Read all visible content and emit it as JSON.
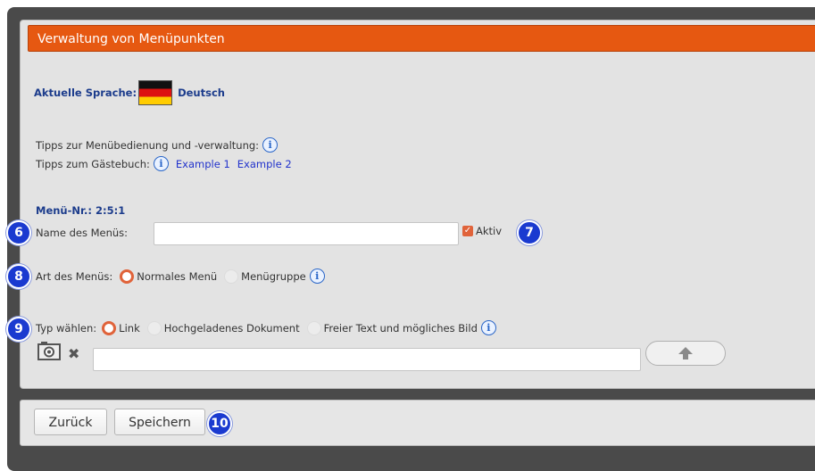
{
  "title": "Verwaltung von Menüpunkten",
  "language": {
    "label": "Aktuelle Sprache:",
    "value": "Deutsch"
  },
  "tips": {
    "menu_tip": "Tipps zur Menübedienung und -verwaltung:",
    "guestbook_tip": "Tipps zum Gästebuch:",
    "example1": "Example 1",
    "example2": "Example 2"
  },
  "menu_nr": "Menü-Nr.: 2:5:1",
  "name_field": {
    "label": "Name des Menüs:",
    "value": "",
    "active_label": "Aktiv",
    "active_checked": true
  },
  "type_field": {
    "label": "Art des Menüs:",
    "option_normal": "Normales Menü",
    "option_group": "Menügruppe",
    "selected": "Normales Menü"
  },
  "kind_field": {
    "label": "Typ wählen:",
    "option_link": "Link",
    "option_upload": "Hochgeladenes Dokument",
    "option_text": "Freier Text und mögliches Bild",
    "selected": "Link",
    "value": ""
  },
  "badges": {
    "b6": "6",
    "b7": "7",
    "b8": "8",
    "b9": "9",
    "b10": "10"
  },
  "info_glyph": "i",
  "buttons": {
    "back": "Zurück",
    "save": "Speichern"
  },
  "colors": {
    "title_bar": "#e65811",
    "badge": "#1a3ad0",
    "accent": "#e0633a",
    "link": "#2233cc"
  },
  "icons": [
    "camera-icon",
    "remove-x-icon",
    "upload-arrow-icon",
    "info-icon",
    "checkbox-checked-icon"
  ]
}
